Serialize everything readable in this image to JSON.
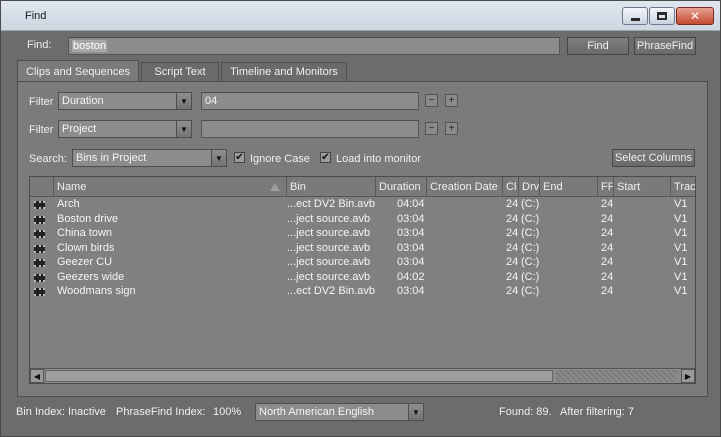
{
  "window": {
    "title": "Find",
    "close_glyph": "✕"
  },
  "find": {
    "label": "Find:",
    "value": "boston",
    "find_button": "Find",
    "phrasefind_button": "PhraseFind"
  },
  "tabs": [
    {
      "label": "Clips and Sequences",
      "active": true
    },
    {
      "label": "Script Text",
      "active": false
    },
    {
      "label": "Timeline and Monitors",
      "active": false
    }
  ],
  "filters": [
    {
      "label": "Filter",
      "field": "Duration",
      "value": "04",
      "minus": "−",
      "plus": "+"
    },
    {
      "label": "Filter",
      "field": "Project",
      "value": "",
      "minus": "−",
      "plus": "+"
    }
  ],
  "search": {
    "label": "Search:",
    "scope": "Bins in Project",
    "ignore_case": {
      "label": "Ignore Case",
      "checked": true
    },
    "load_into_monitor": {
      "label": "Load into monitor",
      "checked": true
    },
    "select_columns": "Select Columns",
    "check_glyph": "✔"
  },
  "table": {
    "columns": [
      "Name",
      "Bin",
      "Duration",
      "Creation Date",
      "Cl",
      "Drv",
      "End",
      "FF",
      "Start",
      "Trac"
    ],
    "rows": [
      {
        "name": "Arch",
        "bin": "...ect DV2 Bin.avb",
        "duration": "04:04",
        "cl": "24",
        "drv": "(C:)",
        "ff": "24",
        "track": "V1"
      },
      {
        "name": "Boston drive",
        "bin": "...ject source.avb",
        "duration": "03:04",
        "cl": "24",
        "drv": "(C:)",
        "ff": "24",
        "track": "V1"
      },
      {
        "name": "China town",
        "bin": "...ject source.avb",
        "duration": "03:04",
        "cl": "24",
        "drv": "(C:)",
        "ff": "24",
        "track": "V1"
      },
      {
        "name": "Clown birds",
        "bin": "...ject source.avb",
        "duration": "03:04",
        "cl": "24",
        "drv": "(C:)",
        "ff": "24",
        "track": "V1"
      },
      {
        "name": "Geezer CU",
        "bin": "...ject source.avb",
        "duration": "03:04",
        "cl": "24",
        "drv": "(C:)",
        "ff": "24",
        "track": "V1"
      },
      {
        "name": "Geezers wide",
        "bin": "...ject source.avb",
        "duration": "04:02",
        "cl": "24",
        "drv": "(C:)",
        "ff": "24",
        "track": "V1"
      },
      {
        "name": "Woodmans sign",
        "bin": "...ect DV2 Bin.avb",
        "duration": "03:04",
        "cl": "24",
        "drv": "(C:)",
        "ff": "24",
        "track": "V1"
      }
    ]
  },
  "status": {
    "bin_index": "Bin Index: Inactive",
    "phrasefind_index": "PhraseFind Index:",
    "phrasefind_percent": "100%",
    "language": "North American English",
    "found": "Found: 89.",
    "after_filtering": "After filtering: 7"
  },
  "icons": {
    "dropdown": "chevron-down-icon",
    "scroll_left": "scroll-left-icon",
    "scroll_right": "scroll-right-icon",
    "clip": "clip-icon",
    "sort": "sort-icon"
  }
}
